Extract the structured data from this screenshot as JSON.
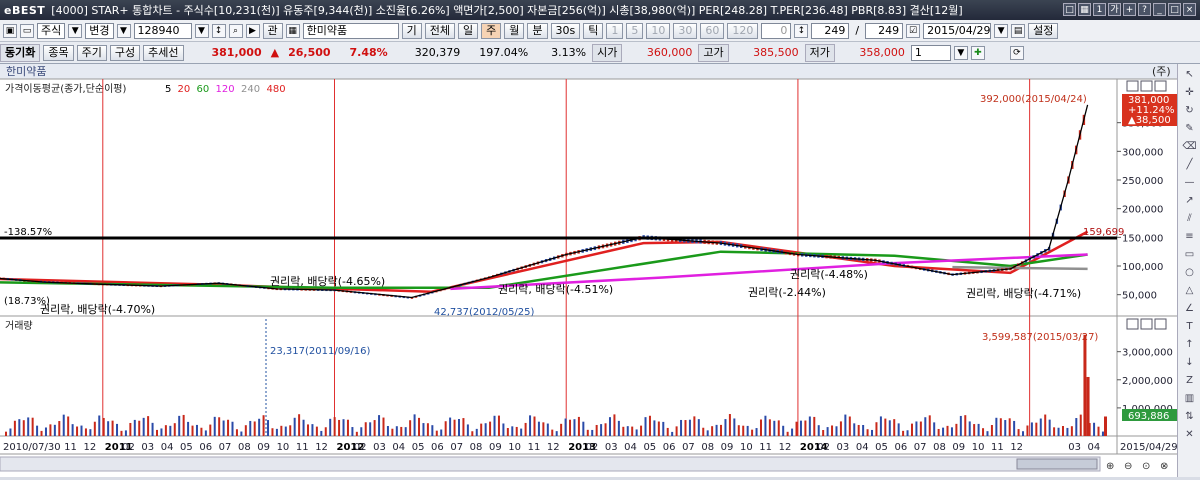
{
  "title_bar": {
    "brand": "eBEST",
    "text": "[4000] STAR+ 통합차트 - 주식수[10,231(천)] 유동주[9,344(천)] 소진율[6.26%] 액면가[2,500] 자본금[256(억)] 시총[38,980(억)] PER[248.28] T.PER[236.48] PBR[8.83] 결산[12월]"
  },
  "toolbar": {
    "market": "주식",
    "change_label": "변경",
    "stock_code": "128940",
    "kwan_label": "관",
    "stock_name": "한미약품",
    "gi_label": "기",
    "all_label": "전체",
    "periods": [
      "일",
      "주",
      "월",
      "분",
      "30s",
      "틱"
    ],
    "selected_period": "주",
    "tick_buttons": [
      "1",
      "5",
      "10",
      "30",
      "60",
      "120"
    ],
    "zero_value": "0",
    "count_value": "249",
    "slash": "/",
    "total_count": "249",
    "date_value": "2015/04/29",
    "settings_label": "설정"
  },
  "quote_bar": {
    "sync_label": "동기화",
    "tabs": [
      "종목",
      "주기",
      "구성",
      "추세선"
    ],
    "price": "381,000",
    "change_arrow": "▲",
    "change": "26,500",
    "change_pct": "7.48%",
    "volume": "320,379",
    "volume_ratio": "197.04%",
    "turnover": "3.13%",
    "open_label": "시가",
    "open": "360,000",
    "high_label": "고가",
    "high": "385,500",
    "low_label": "저가",
    "low": "358,000",
    "split_value": "1"
  },
  "chart": {
    "stock_title": "한미약품",
    "unit_label": "(주)",
    "price_panel_title": "가격이동평균(종가,단순이평)",
    "ma_periods": [
      {
        "label": "5",
        "color": "#000000"
      },
      {
        "label": "20",
        "color": "#e02020"
      },
      {
        "label": "60",
        "color": "#1a9a1a"
      },
      {
        "label": "120",
        "color": "#e020e0"
      },
      {
        "label": "240",
        "color": "#909090"
      },
      {
        "label": "480",
        "color": "#e02020"
      }
    ],
    "volume_panel_title": "거래량",
    "price_axis": [
      "350,000",
      "300,000",
      "250,000",
      "200,000",
      "150,000",
      "100,000",
      "50,000"
    ],
    "volume_axis": [
      "3,000,000",
      "2,000,000",
      "1,000,000"
    ],
    "current_price_box": [
      "381,000",
      "+11.24%",
      "▲38,500"
    ],
    "current_volume_box": "693,886",
    "hline_label": "-138.57%",
    "hline_value": "159,699",
    "left_price_label": "(18.73%)",
    "annotations": [
      {
        "text": "392,000(2015/04/24)"
      },
      {
        "text": "42,737(2012/05/25)"
      },
      {
        "text": "권리락, 배당락(-4.70%)"
      },
      {
        "text": "권리락, 배당락(-4.65%)"
      },
      {
        "text": "권리락, 배당락(-4.51%)"
      },
      {
        "text": "권리락(-2.44%)"
      },
      {
        "text": "권리락(-4.48%)"
      },
      {
        "text": "권리락, 배당락(-4.71%)"
      },
      {
        "text": "3,599,587(2015/03/27)"
      },
      {
        "text": "23,317(2011/09/16)"
      }
    ],
    "x_axis": {
      "start": "2010/07/30",
      "end": "2015/04/29",
      "years": [
        "2011",
        "2012",
        "2013",
        "2014",
        "2015"
      ],
      "months": [
        "11",
        "12",
        "02",
        "03",
        "04",
        "05",
        "06",
        "07",
        "08",
        "09",
        "10",
        "11",
        "12",
        "02",
        "03",
        "04",
        "05",
        "06",
        "07",
        "08",
        "09",
        "10",
        "11",
        "12",
        "02",
        "03",
        "04",
        "05",
        "06",
        "07",
        "08",
        "09",
        "10",
        "11",
        "12",
        "02",
        "03",
        "04",
        "05",
        "06",
        "07",
        "08",
        "09",
        "10",
        "11",
        "12",
        "03",
        "04"
      ]
    }
  },
  "chart_data": {
    "type": "line",
    "x_range": [
      "2010/07/30",
      "2015/04/29"
    ],
    "y_range": [
      25000,
      400000
    ],
    "price_series": [
      {
        "date": "2010/07",
        "value": 80000
      },
      {
        "date": "2010/10",
        "value": 72000
      },
      {
        "date": "2011/01",
        "value": 68000
      },
      {
        "date": "2011/04",
        "value": 65000
      },
      {
        "date": "2011/07",
        "value": 70000
      },
      {
        "date": "2011/10",
        "value": 60000
      },
      {
        "date": "2012/01",
        "value": 58000
      },
      {
        "date": "2012/05",
        "value": 45000
      },
      {
        "date": "2012/09",
        "value": 80000
      },
      {
        "date": "2013/01",
        "value": 120000
      },
      {
        "date": "2013/05",
        "value": 150000
      },
      {
        "date": "2013/09",
        "value": 140000
      },
      {
        "date": "2014/01",
        "value": 120000
      },
      {
        "date": "2014/05",
        "value": 110000
      },
      {
        "date": "2014/09",
        "value": 85000
      },
      {
        "date": "2014/12",
        "value": 95000
      },
      {
        "date": "2015/02",
        "value": 130000
      },
      {
        "date": "2015/03",
        "value": 250000
      },
      {
        "date": "2015/04",
        "value": 381000
      }
    ],
    "ma_series": [
      {
        "name": "20",
        "color": "#e02020",
        "values": [
          {
            "date": "2010/07",
            "value": 78000
          },
          {
            "date": "2011/06",
            "value": 68000
          },
          {
            "date": "2012/06",
            "value": 55000
          },
          {
            "date": "2013/05",
            "value": 140000
          },
          {
            "date": "2013/09",
            "value": 142000
          },
          {
            "date": "2014/06",
            "value": 100000
          },
          {
            "date": "2014/12",
            "value": 88000
          },
          {
            "date": "2015/04",
            "value": 160000
          }
        ]
      },
      {
        "name": "60",
        "color": "#1a9a1a",
        "values": [
          {
            "date": "2010/07",
            "value": 72000
          },
          {
            "date": "2012/01",
            "value": 62000
          },
          {
            "date": "2012/09",
            "value": 62000
          },
          {
            "date": "2013/09",
            "value": 125000
          },
          {
            "date": "2014/06",
            "value": 118000
          },
          {
            "date": "2014/12",
            "value": 100000
          },
          {
            "date": "2015/04",
            "value": 120000
          }
        ]
      },
      {
        "name": "120",
        "color": "#e020e0",
        "values": [
          {
            "date": "2012/07",
            "value": 60000
          },
          {
            "date": "2013/06",
            "value": 80000
          },
          {
            "date": "2014/06",
            "value": 105000
          },
          {
            "date": "2015/04",
            "value": 120000
          }
        ]
      },
      {
        "name": "240",
        "color": "#909090",
        "values": [
          {
            "date": "2014/09",
            "value": 98000
          },
          {
            "date": "2015/04",
            "value": 95000
          }
        ]
      }
    ],
    "volume_series": [
      {
        "date": "2015/03/27",
        "value": 3599587
      },
      {
        "date": "2015/04",
        "value": 2100000
      },
      {
        "date": "2015/04/29",
        "value": 693886
      }
    ],
    "volume_y_range": [
      0,
      3700000
    ]
  }
}
